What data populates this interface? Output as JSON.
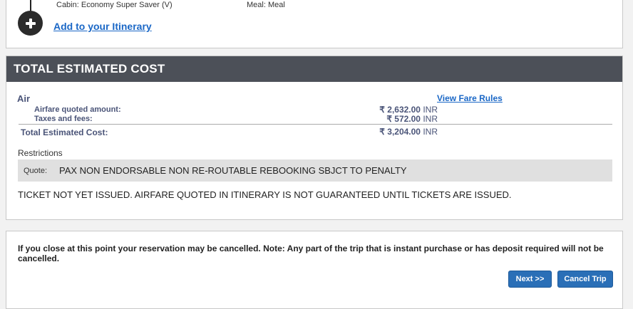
{
  "itinerary": {
    "cabin": "Cabin: Economy Super Saver (V)",
    "meal": "Meal: Meal",
    "add_link": "Add to your Itinerary"
  },
  "cost": {
    "header": "TOTAL ESTIMATED COST",
    "air_label": "Air",
    "fare_rules": "View Fare Rules",
    "airfare_label": "Airfare quoted amount:",
    "airfare_amount": "₹ 2,632.00",
    "airfare_currency": "INR",
    "taxes_label": "Taxes and fees:",
    "taxes_amount": "₹ 572.00",
    "taxes_currency": "INR",
    "total_label": "Total Estimated Cost:",
    "total_amount": "₹ 3,204.00",
    "total_currency": "INR",
    "restrictions_label": "Restrictions",
    "quote_label": "Quote:",
    "quote_text": "PAX NON ENDORSABLE NON RE-ROUTABLE REBOOKING SBJCT TO PENALTY",
    "ticket_note": "TICKET NOT YET ISSUED. AIRFARE QUOTED IN ITINERARY IS NOT GUARANTEED UNTIL TICKETS ARE ISSUED."
  },
  "footer": {
    "note": "If you close at this point your reservation may be cancelled. Note: Any part of the trip that is instant purchase or has deposit required will not be cancelled.",
    "next_label": "Next >>",
    "cancel_label": "Cancel Trip"
  },
  "colors": {
    "header_bg": "#4c5058",
    "link": "#1a67c6",
    "button": "#2a6fb7"
  }
}
